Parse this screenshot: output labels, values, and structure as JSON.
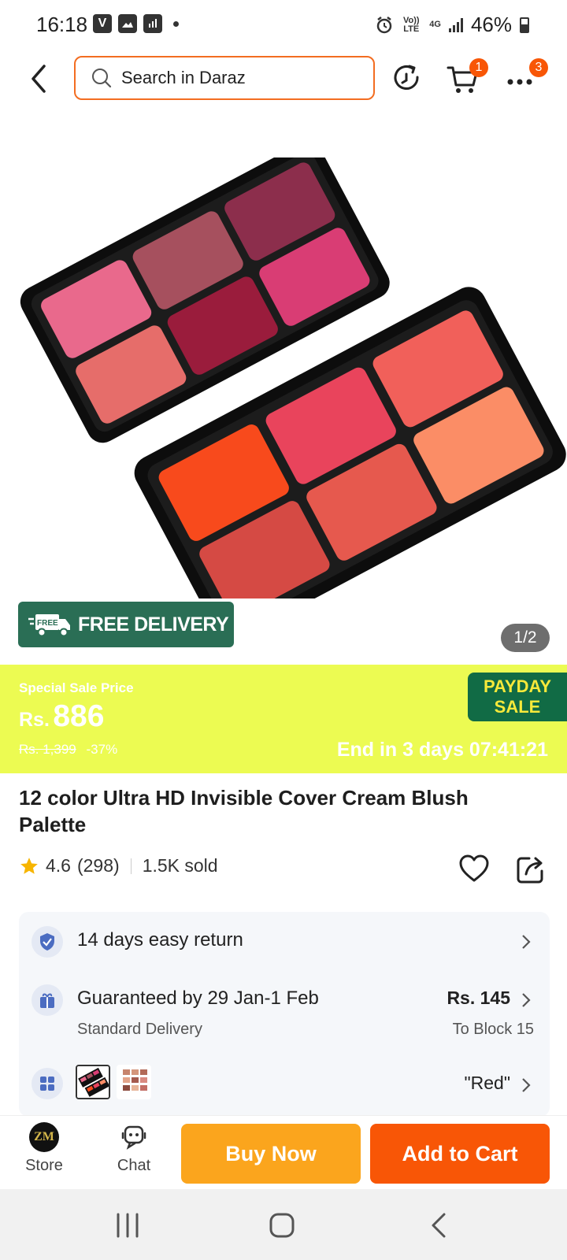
{
  "status_bar": {
    "time": "16:18",
    "battery": "46%",
    "icons": [
      "v-icon",
      "image-icon",
      "sim-icon",
      "dot"
    ],
    "right_icons": [
      "alarm-icon",
      "volte-icon",
      "4g-icon",
      "signal-icon",
      "battery-icon"
    ],
    "volte": "Vo)) LTE",
    "net": "4G"
  },
  "header": {
    "search_placeholder": "Search in Daraz",
    "cart_badge": "1",
    "more_badge": "3"
  },
  "product": {
    "free_delivery": "FREE DELIVERY",
    "free_tag": "FREE",
    "image_counter": "1/2",
    "title": "12 color Ultra HD Invisible Cover Cream Blush Palette",
    "rating": "4.6",
    "reviews": "(298)",
    "sold": "1.5K sold"
  },
  "sale": {
    "label": "Special Sale Price",
    "currency": "Rs.",
    "price": "886",
    "old_price": "Rs. 1,399",
    "discount": "-37%",
    "ends": "End in 3 days 07:41:21",
    "badge_line1": "PAYDAY",
    "badge_line2": "SALE"
  },
  "info": {
    "return": "14 days easy return",
    "guarantee": "Guaranteed by 29 Jan-1 Feb",
    "delivery_type": "Standard Delivery",
    "delivery_fee": "Rs. 145",
    "delivery_to": "To Block 15",
    "variant": "\"Red\""
  },
  "bottom_bar": {
    "store_label": "Store",
    "chat_label": "Chat",
    "store_logo": "ZM",
    "buy_now": "Buy Now",
    "add_to_cart": "Add to Cart"
  },
  "colors": {
    "accent": "#f85606",
    "buy_now": "#fba51d",
    "sale_bg": "#ecfb52",
    "free_delivery_bg": "#2a6e55"
  }
}
